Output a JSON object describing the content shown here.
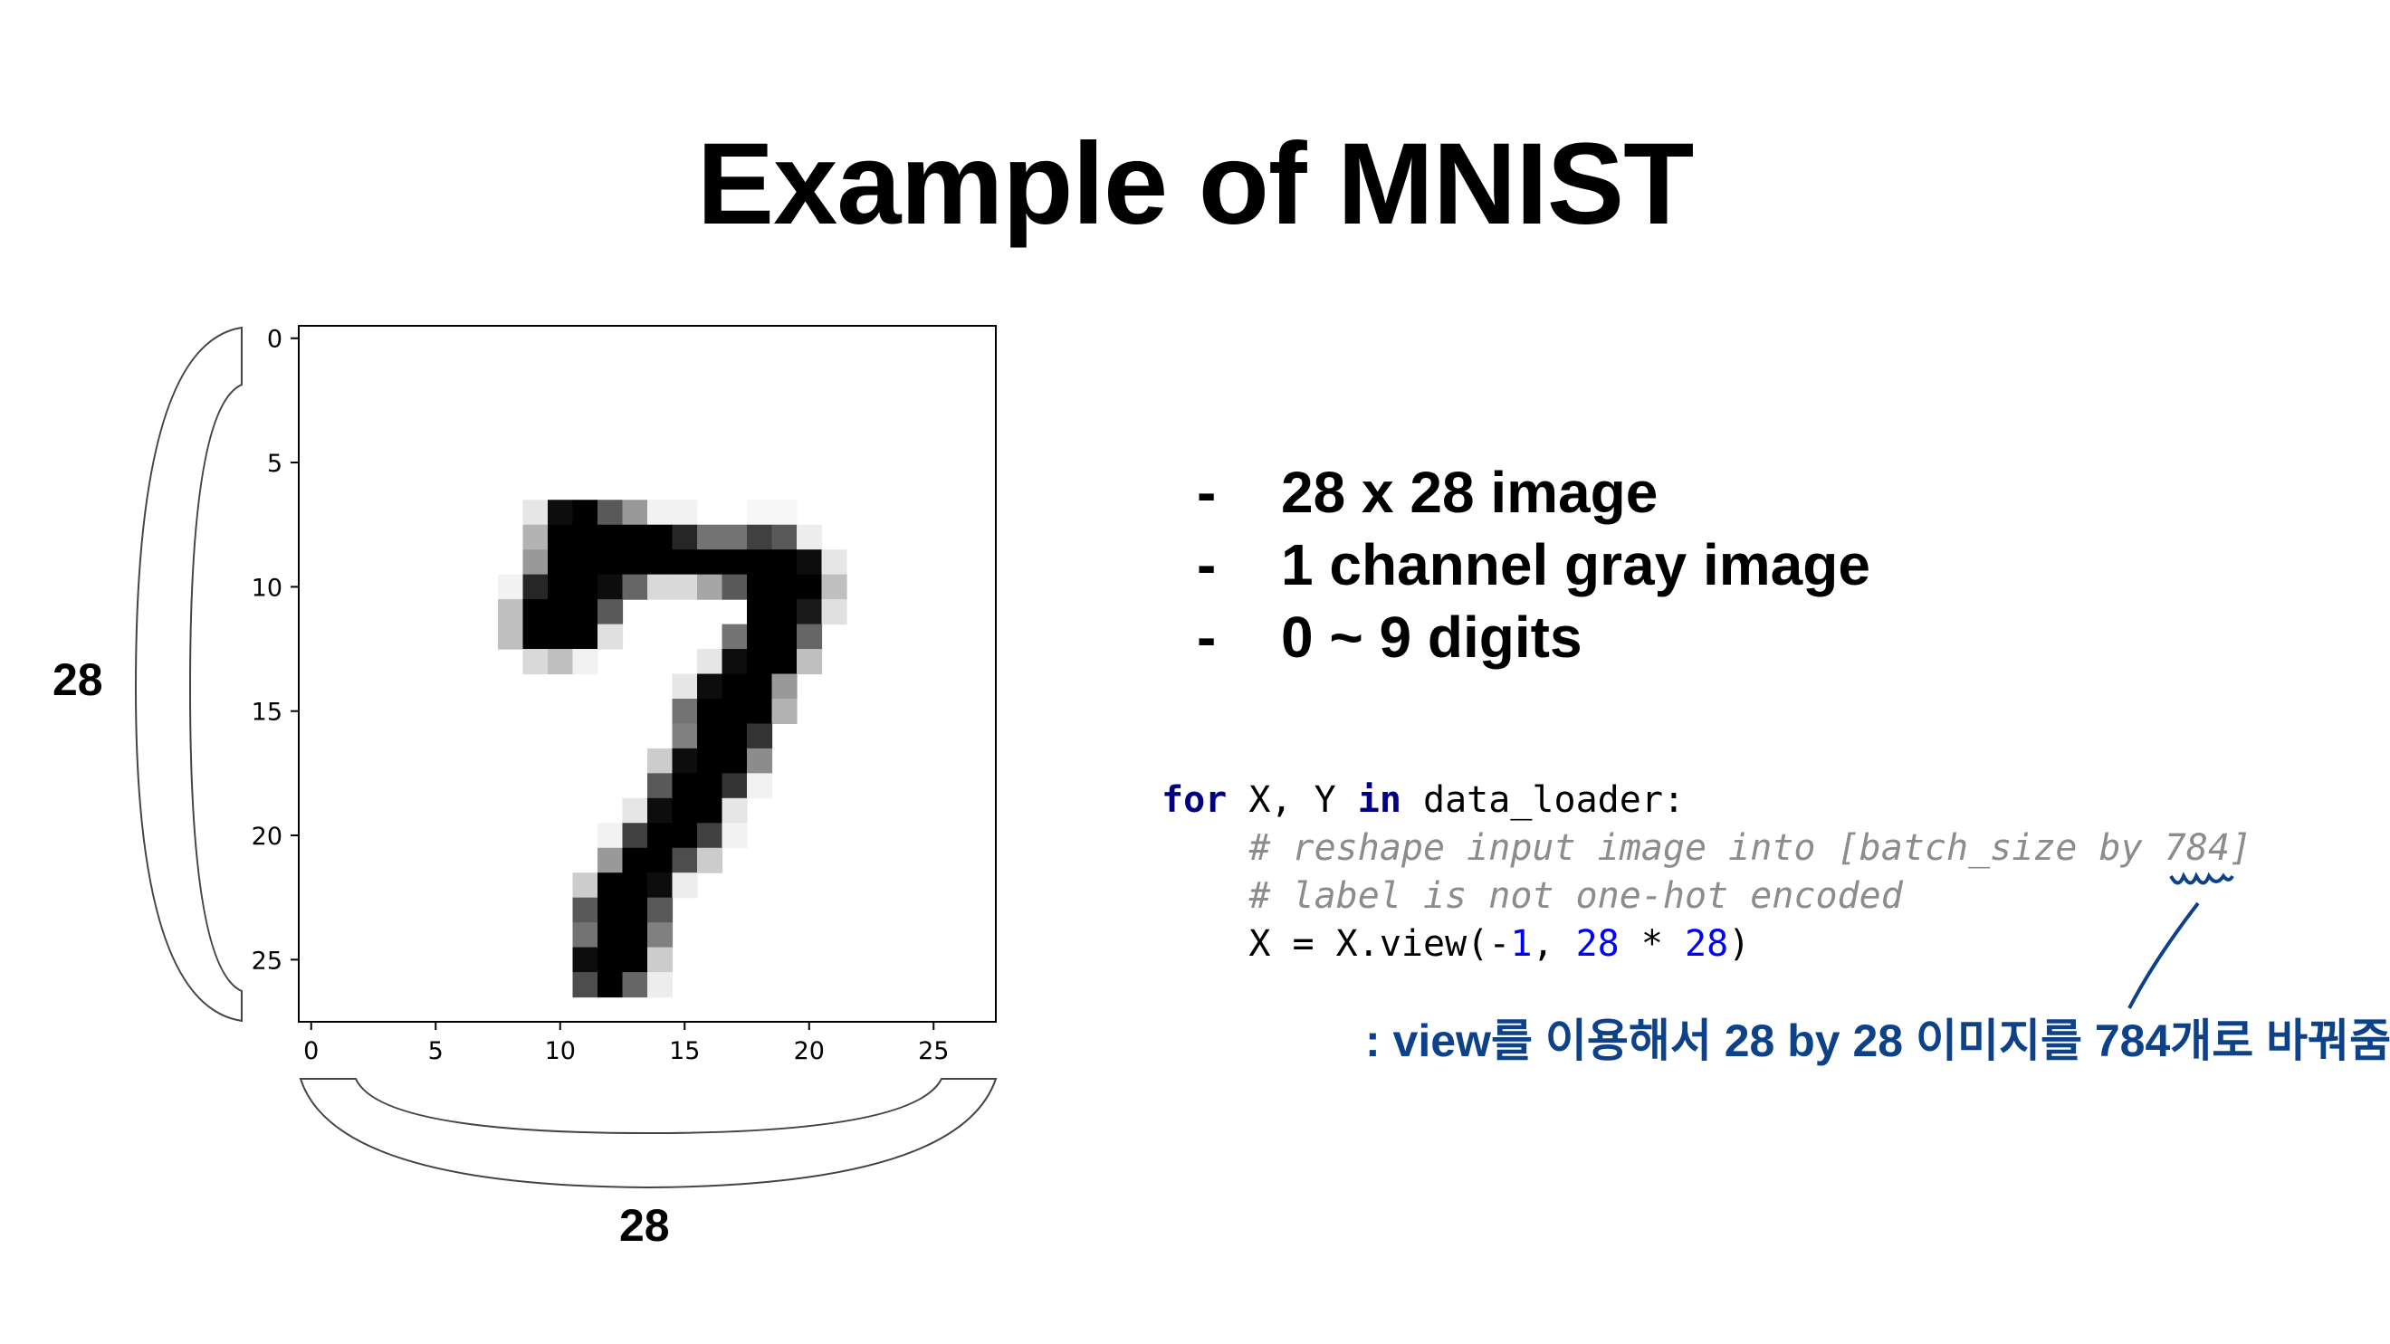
{
  "title": "Example of MNIST",
  "bullets": [
    {
      "marker": "-",
      "text": "28 x 28 image"
    },
    {
      "marker": "-",
      "text": "1 channel gray image"
    },
    {
      "marker": "-",
      "text": "0 ~ 9 digits"
    }
  ],
  "code": {
    "line1": {
      "kw1": "for",
      "t1": " X, Y ",
      "kw2": "in",
      "t2": " data_loader:"
    },
    "line2": "    # reshape input image into [batch_size by 784]",
    "line3": "    # label is not one-hot encoded",
    "line4": {
      "t1": "    X = X.view(-",
      "n1": "1",
      "t2": ", ",
      "n2": "28",
      "t3": " * ",
      "n3": "28",
      "t4": ")"
    }
  },
  "annotation": {
    "text": ": view를 이용해서 28 by 28 이미지를 784개로 바꿔줌",
    "color": "#0e4288"
  },
  "dimensions": {
    "height_label": "28",
    "width_label": "28"
  },
  "chart_data": {
    "type": "heatmap",
    "colormap": "gray_r",
    "shape": [
      28,
      28
    ],
    "xticks": [
      "0",
      "5",
      "10",
      "15",
      "20",
      "25"
    ],
    "yticks": [
      "0",
      "5",
      "10",
      "15",
      "20",
      "25"
    ],
    "xlim": [
      -0.5,
      27.5
    ],
    "ylim": [
      27.5,
      -0.5
    ],
    "pixels_row_col_intensity": [
      [
        7,
        9,
        0.1
      ],
      [
        7,
        10,
        0.95
      ],
      [
        7,
        11,
        1
      ],
      [
        7,
        12,
        0.65
      ],
      [
        7,
        13,
        0.4
      ],
      [
        7,
        14,
        0.05
      ],
      [
        7,
        15,
        0.05
      ],
      [
        7,
        18,
        0.03
      ],
      [
        7,
        19,
        0.03
      ],
      [
        8,
        9,
        0.3
      ],
      [
        8,
        10,
        1
      ],
      [
        8,
        11,
        1
      ],
      [
        8,
        12,
        1
      ],
      [
        8,
        13,
        1
      ],
      [
        8,
        14,
        1
      ],
      [
        8,
        15,
        0.85
      ],
      [
        8,
        16,
        0.55
      ],
      [
        8,
        17,
        0.55
      ],
      [
        8,
        18,
        0.75
      ],
      [
        8,
        19,
        0.65
      ],
      [
        8,
        20,
        0.07
      ],
      [
        9,
        9,
        0.4
      ],
      [
        9,
        10,
        1
      ],
      [
        9,
        11,
        1
      ],
      [
        9,
        12,
        1
      ],
      [
        9,
        13,
        1
      ],
      [
        9,
        14,
        1
      ],
      [
        9,
        15,
        1
      ],
      [
        9,
        16,
        1
      ],
      [
        9,
        17,
        1
      ],
      [
        9,
        18,
        1
      ],
      [
        9,
        19,
        1
      ],
      [
        9,
        20,
        0.95
      ],
      [
        9,
        21,
        0.1
      ],
      [
        10,
        8,
        0.05
      ],
      [
        10,
        9,
        0.85
      ],
      [
        10,
        10,
        1
      ],
      [
        10,
        11,
        1
      ],
      [
        10,
        12,
        0.95
      ],
      [
        10,
        13,
        0.6
      ],
      [
        10,
        14,
        0.15
      ],
      [
        10,
        15,
        0.15
      ],
      [
        10,
        16,
        0.35
      ],
      [
        10,
        17,
        0.65
      ],
      [
        10,
        18,
        1
      ],
      [
        10,
        19,
        1
      ],
      [
        10,
        20,
        1
      ],
      [
        10,
        21,
        0.25
      ],
      [
        11,
        8,
        0.25
      ],
      [
        11,
        9,
        1
      ],
      [
        11,
        10,
        1
      ],
      [
        11,
        11,
        1
      ],
      [
        11,
        12,
        0.65
      ],
      [
        11,
        18,
        1
      ],
      [
        11,
        19,
        1
      ],
      [
        11,
        20,
        0.9
      ],
      [
        11,
        21,
        0.12
      ],
      [
        12,
        8,
        0.25
      ],
      [
        12,
        9,
        1
      ],
      [
        12,
        10,
        1
      ],
      [
        12,
        11,
        1
      ],
      [
        12,
        12,
        0.12
      ],
      [
        12,
        17,
        0.55
      ],
      [
        12,
        18,
        1
      ],
      [
        12,
        19,
        1
      ],
      [
        12,
        20,
        0.6
      ],
      [
        13,
        9,
        0.15
      ],
      [
        13,
        10,
        0.25
      ],
      [
        13,
        11,
        0.05
      ],
      [
        13,
        16,
        0.1
      ],
      [
        13,
        17,
        0.95
      ],
      [
        13,
        18,
        1
      ],
      [
        13,
        19,
        1
      ],
      [
        13,
        20,
        0.25
      ],
      [
        14,
        15,
        0.1
      ],
      [
        14,
        16,
        0.95
      ],
      [
        14,
        17,
        1
      ],
      [
        14,
        18,
        1
      ],
      [
        14,
        19,
        0.4
      ],
      [
        15,
        15,
        0.55
      ],
      [
        15,
        16,
        1
      ],
      [
        15,
        17,
        1
      ],
      [
        15,
        18,
        1
      ],
      [
        15,
        19,
        0.3
      ],
      [
        16,
        15,
        0.5
      ],
      [
        16,
        16,
        1
      ],
      [
        16,
        17,
        1
      ],
      [
        16,
        18,
        0.8
      ],
      [
        17,
        14,
        0.2
      ],
      [
        17,
        15,
        0.95
      ],
      [
        17,
        16,
        1
      ],
      [
        17,
        17,
        1
      ],
      [
        17,
        18,
        0.45
      ],
      [
        18,
        14,
        0.65
      ],
      [
        18,
        15,
        1
      ],
      [
        18,
        16,
        1
      ],
      [
        18,
        17,
        0.8
      ],
      [
        18,
        18,
        0.05
      ],
      [
        19,
        13,
        0.1
      ],
      [
        19,
        14,
        0.95
      ],
      [
        19,
        15,
        1
      ],
      [
        19,
        16,
        1
      ],
      [
        19,
        17,
        0.1
      ],
      [
        20,
        12,
        0.05
      ],
      [
        20,
        13,
        0.75
      ],
      [
        20,
        14,
        1
      ],
      [
        20,
        15,
        1
      ],
      [
        20,
        16,
        0.75
      ],
      [
        20,
        17,
        0.05
      ],
      [
        21,
        12,
        0.4
      ],
      [
        21,
        13,
        1
      ],
      [
        21,
        14,
        1
      ],
      [
        21,
        15,
        0.7
      ],
      [
        21,
        16,
        0.2
      ],
      [
        22,
        11,
        0.2
      ],
      [
        22,
        12,
        1
      ],
      [
        22,
        13,
        1
      ],
      [
        22,
        14,
        0.95
      ],
      [
        22,
        15,
        0.07
      ],
      [
        23,
        11,
        0.65
      ],
      [
        23,
        12,
        1
      ],
      [
        23,
        13,
        1
      ],
      [
        23,
        14,
        0.65
      ],
      [
        24,
        11,
        0.55
      ],
      [
        24,
        12,
        1
      ],
      [
        24,
        13,
        1
      ],
      [
        24,
        14,
        0.5
      ],
      [
        25,
        11,
        0.95
      ],
      [
        25,
        12,
        1
      ],
      [
        25,
        13,
        1
      ],
      [
        25,
        14,
        0.2
      ],
      [
        26,
        11,
        0.7
      ],
      [
        26,
        12,
        1
      ],
      [
        26,
        13,
        0.6
      ],
      [
        26,
        14,
        0.07
      ]
    ]
  }
}
